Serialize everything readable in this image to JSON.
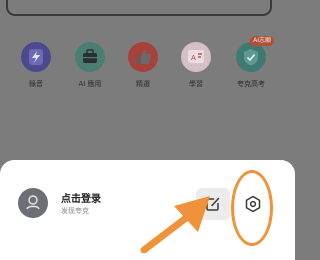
{
  "grid": {
    "items": [
      {
        "label": "錄音",
        "icon": "lightning-icon",
        "color": "#4b4a8e"
      },
      {
        "label": "AI 應用",
        "icon": "briefcase-icon",
        "color": "#4a7e72"
      },
      {
        "label": "精選",
        "icon": "thumbs-up-icon",
        "color": "#a6423c"
      },
      {
        "label": "學習",
        "icon": "ai-board-icon",
        "color": "#d4c1c8"
      },
      {
        "label": "夸克高考",
        "icon": "shield-check-icon",
        "color": "#3f7a72",
        "badge": "AI志願"
      }
    ]
  },
  "account": {
    "title": "点击登录",
    "subtitle": "发现夸克"
  },
  "colors": {
    "annotation": "#f0923a",
    "sheet": "#ffffff",
    "overlay": "#7c7c7c"
  }
}
